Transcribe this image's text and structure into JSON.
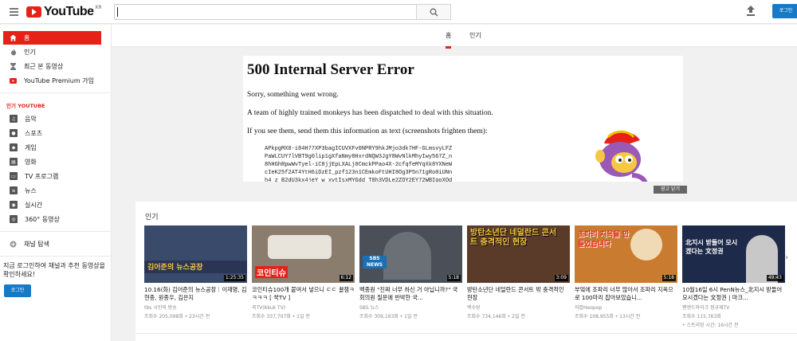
{
  "header": {
    "logo_text": "YouTube",
    "region": "KR",
    "search_placeholder": "",
    "login_label": "로그인"
  },
  "sidebar": {
    "items": [
      {
        "label": "홈",
        "icon": "home-icon"
      },
      {
        "label": "인기",
        "icon": "flame-icon"
      },
      {
        "label": "최근 본 동영상",
        "icon": "hourglass-icon"
      },
      {
        "label": "YouTube Premium 가입",
        "icon": "youtube-icon"
      }
    ],
    "section_title": "인기 YOUTUBE",
    "channels": [
      {
        "label": "음악"
      },
      {
        "label": "스포츠"
      },
      {
        "label": "게임"
      },
      {
        "label": "영화"
      },
      {
        "label": "TV 프로그램"
      },
      {
        "label": "뉴스"
      },
      {
        "label": "실시간"
      },
      {
        "label": "360° 동영상"
      }
    ],
    "browse_label": "채널 탐색",
    "note": "지금 로그인하여 채널과 추천 동영상을 확인하세요!",
    "login_label": "로그인"
  },
  "tabs": [
    {
      "label": "홈"
    },
    {
      "label": "인기"
    }
  ],
  "ad": {
    "title": "500 Internal Server Error",
    "line1": "Sorry, something went wrong.",
    "line2": "A team of highly trained monkeys has been dispatched to deal with this situation.",
    "line3": "If you see them, send them this information as text (screenshots frighten them):",
    "code": "APkpgMX0-i84H77XP3bagICUVXFv0NPRY9hkJMjo3dk7HF-GLmsvyLFZ\nPaWLCUY7lVBT9g0lip1gXfaNmy8HxrdNQW3JgY8WvNlkMhyIwy567Z_n\n8hHGhRpwWvTyel-iC8jjEpLXALj0CmckPPao4X-2cfqfeMYqXk8YXNeW\ncIeK25f2AT4YtH6iDzEI_pzf123n1CEmkoFtUHI8Og3P5n71gRo0iUNn\nh4 z B2dU3kx4jeY w xvtIsxMYGdd T8h3VDLe2ZQY2EY72WBIqoXOd",
    "close_label": "광고 닫기"
  },
  "popular": {
    "title": "인기",
    "videos": [
      {
        "title": "10.16(화) 김어준의 뉴스공장｜이재명, 김현종, 원종우, 김은지",
        "channel": "tbs 시민의 방송",
        "meta": "조회수 205,098회 • 23시간 전",
        "duration": "1:25:35",
        "thumb_text": "김어준의 뉴스공장",
        "thumb_color": "#3a4a6b"
      },
      {
        "title": "코인티슈100개 붙여서 넣으니 ㄷㄷ 꿀잼ㅋㅋㅋㅋ [ 꾹TV ]",
        "channel": "꾹TV(Kkuk TV)",
        "meta": "조회수 337,707회 • 1일 전",
        "duration": "6:12",
        "thumb_text": "코인티슈",
        "thumb_color": "#8a7d6e"
      },
      {
        "title": "백종원 \"진짜 너무 하신 거 아닙니까?\" 국회의원 질문에 반박한 국...",
        "channel": "SBS 뉴스",
        "meta": "조회수 309,193회 • 1일 전",
        "duration": "5:18",
        "thumb_text": "SBS NEWS",
        "thumb_color": "#4a4f58"
      },
      {
        "title": "방탄소년단 네덜란드 콘서트 밖 충격적인 현장",
        "channel": "백수랑",
        "meta": "조회수 734,146회 • 2일 전",
        "duration": "3:09",
        "thumb_text": "방탄소년단 네덜란드 콘서트 충격적인 현장",
        "thumb_color": "#5a3b2a"
      },
      {
        "title": "부엌에 조파리 너무 많아서 조파리 지옥으로 100마리 잡아보았습니...",
        "channel": "허팝Heopop",
        "meta": "조회수 108,955회 • 13시간 전",
        "duration": "5:18",
        "thumb_text": "초파리 지옥을 만들었습니다",
        "thumb_color": "#c97b2f"
      },
      {
        "title": "10월16일 6시 PenN뉴스_北지시 받들어 모시겠다는 文정권 | 마크...",
        "channel": "펜앤드마이크 정규재TV",
        "meta": "조회수 115,763회",
        "meta2": "• 스트리밍 시간: 16시간 전",
        "duration": "49:43",
        "thumb_text": "北지시 받들어 모시겠다는 文정권",
        "thumb_color": "#1e2a4a"
      }
    ]
  }
}
